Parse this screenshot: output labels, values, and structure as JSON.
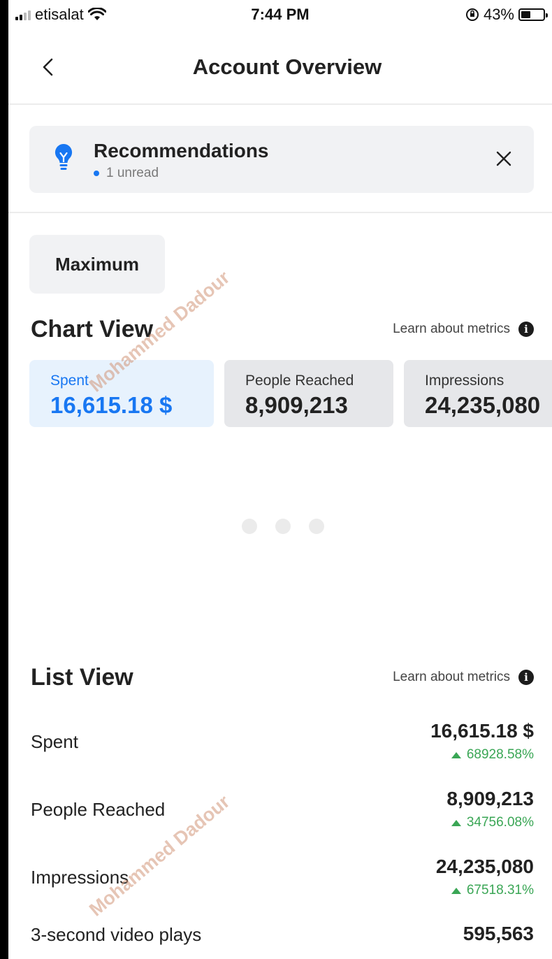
{
  "status_bar": {
    "carrier": "etisalat",
    "time": "7:44 PM",
    "battery_percent": "43%",
    "battery_level": 0.43
  },
  "header": {
    "title": "Account Overview"
  },
  "recommendations": {
    "title": "Recommendations",
    "unread": "1 unread"
  },
  "date_range": {
    "label": "Maximum"
  },
  "chart_view": {
    "title": "Chart View",
    "learn_link": "Learn about metrics",
    "tiles": [
      {
        "label": "Spent",
        "value": "16,615.18 $",
        "selected": true
      },
      {
        "label": "People Reached",
        "value": "8,909,213",
        "selected": false
      },
      {
        "label": "Impressions",
        "value": "24,235,080",
        "selected": false
      }
    ]
  },
  "list_view": {
    "title": "List View",
    "learn_link": "Learn about metrics",
    "rows": [
      {
        "label": "Spent",
        "value": "16,615.18 $",
        "change": "68928.58%"
      },
      {
        "label": "People Reached",
        "value": "8,909,213",
        "change": "34756.08%"
      },
      {
        "label": "Impressions",
        "value": "24,235,080",
        "change": "67518.31%"
      },
      {
        "label": "3-second video plays",
        "value": "595,563"
      }
    ]
  },
  "watermark": "Mohammed Dadour",
  "colors": {
    "accent": "#1877f2",
    "positive": "#3aa655",
    "card_bg": "#f1f2f4"
  }
}
